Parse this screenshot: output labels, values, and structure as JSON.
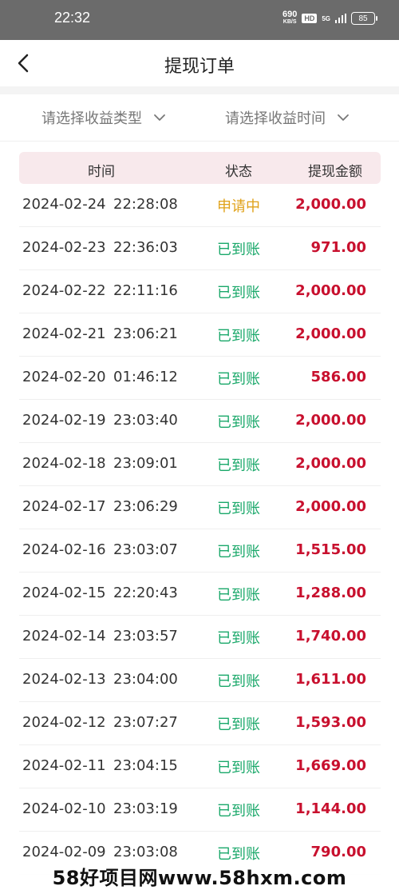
{
  "status_bar": {
    "time": "22:32",
    "net_speed_value": "690",
    "net_speed_unit": "KB/S",
    "hd": "HD",
    "signal": "5G",
    "battery": "85"
  },
  "header": {
    "title": "提现订单"
  },
  "filters": {
    "type_label": "请选择收益类型",
    "time_label": "请选择收益时间"
  },
  "table": {
    "col_time": "时间",
    "col_status": "状态",
    "col_amount": "提现金额",
    "rows": [
      {
        "date": "2024-02-24",
        "time": "22:28:08",
        "status": "申请中",
        "amount": "2,000.00"
      },
      {
        "date": "2024-02-23",
        "time": "22:36:03",
        "status": "已到账",
        "amount": "971.00"
      },
      {
        "date": "2024-02-22",
        "time": "22:11:16",
        "status": "已到账",
        "amount": "2,000.00"
      },
      {
        "date": "2024-02-21",
        "time": "23:06:21",
        "status": "已到账",
        "amount": "2,000.00"
      },
      {
        "date": "2024-02-20",
        "time": "01:46:12",
        "status": "已到账",
        "amount": "586.00"
      },
      {
        "date": "2024-02-19",
        "time": "23:03:40",
        "status": "已到账",
        "amount": "2,000.00"
      },
      {
        "date": "2024-02-18",
        "time": "23:09:01",
        "status": "已到账",
        "amount": "2,000.00"
      },
      {
        "date": "2024-02-17",
        "time": "23:06:29",
        "status": "已到账",
        "amount": "2,000.00"
      },
      {
        "date": "2024-02-16",
        "time": "23:03:07",
        "status": "已到账",
        "amount": "1,515.00"
      },
      {
        "date": "2024-02-15",
        "time": "22:20:43",
        "status": "已到账",
        "amount": "1,288.00"
      },
      {
        "date": "2024-02-14",
        "time": "23:03:57",
        "status": "已到账",
        "amount": "1,740.00"
      },
      {
        "date": "2024-02-13",
        "time": "23:04:00",
        "status": "已到账",
        "amount": "1,611.00"
      },
      {
        "date": "2024-02-12",
        "time": "23:07:27",
        "status": "已到账",
        "amount": "1,593.00"
      },
      {
        "date": "2024-02-11",
        "time": "23:04:15",
        "status": "已到账",
        "amount": "1,669.00"
      },
      {
        "date": "2024-02-10",
        "time": "23:03:19",
        "status": "已到账",
        "amount": "1,144.00"
      },
      {
        "date": "2024-02-09",
        "time": "23:03:08",
        "status": "已到账",
        "amount": "790.00"
      }
    ]
  },
  "colors": {
    "status_pending": "#e0a21a",
    "status_done": "#1aa86a",
    "amount": "#c8102e",
    "header_band": "#f8e9ec"
  },
  "icons": {
    "back": "chevron-left-icon",
    "dropdown": "chevron-down-icon"
  },
  "watermark": "58好项目网www.58hxm.com"
}
